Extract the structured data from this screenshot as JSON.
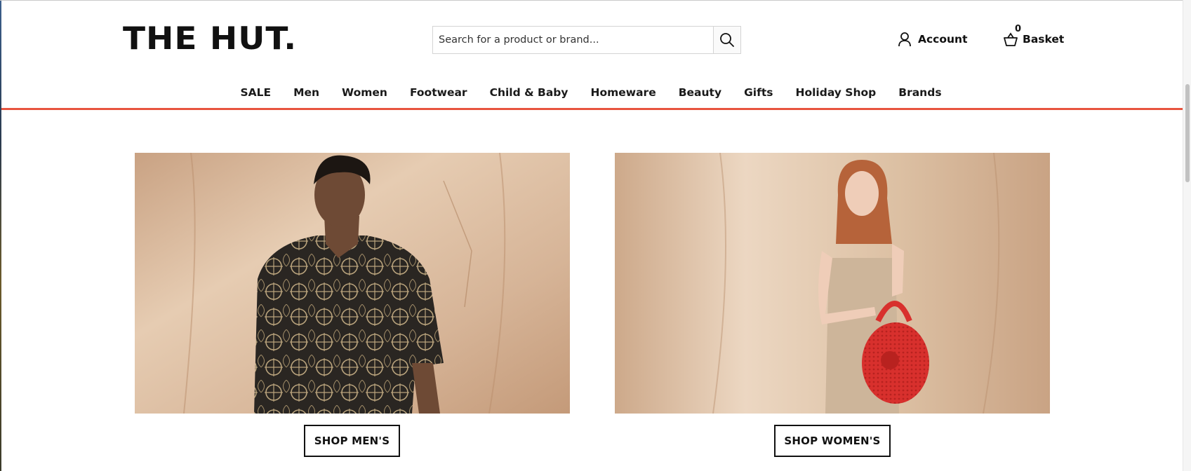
{
  "header": {
    "logo_text": "THE HUT.",
    "search": {
      "placeholder": "Search for a product or brand..."
    },
    "account_label": "Account",
    "basket_label": "Basket",
    "basket_count": "0"
  },
  "nav": {
    "items": [
      "SALE",
      "Men",
      "Women",
      "Footwear",
      "Child & Baby",
      "Homeware",
      "Beauty",
      "Gifts",
      "Holiday Shop",
      "Brands"
    ]
  },
  "promos": {
    "men": {
      "button_label": "SHOP MEN'S"
    },
    "women": {
      "button_label": "SHOP WOMEN'S"
    }
  },
  "colors": {
    "accent_divider": "#e8543f",
    "backdrop": "#d9b89a",
    "bag": "#d8302d"
  },
  "icons": {
    "search": "search-icon",
    "account": "user-icon",
    "basket": "basket-icon"
  }
}
